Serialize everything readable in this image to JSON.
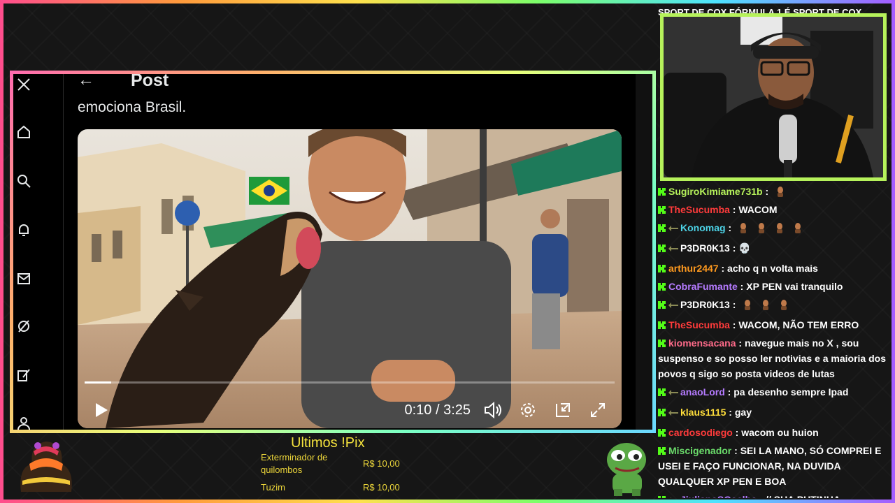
{
  "post": {
    "back_icon": "←",
    "title": "Post",
    "text": "emociona Brasil."
  },
  "sidebar": {
    "icons": [
      "x-logo-icon",
      "home-icon",
      "search-icon",
      "notifications-icon",
      "messages-icon",
      "grok-icon",
      "compose-icon",
      "profile-icon"
    ]
  },
  "video": {
    "time": "0:10 / 3:25",
    "progress": 0.05
  },
  "marquee": {
    "text": "SPORT DE COX FÓRMULA 1 É SPORT DE COX"
  },
  "chat": {
    "messages": [
      {
        "user": "SugiroKimiame731b",
        "color": "#b6f25b",
        "text": "",
        "emotes": 1,
        "sub": false
      },
      {
        "user": "TheSucumba",
        "color": "#ff3b3b",
        "text": "WACOM",
        "emotes": 0,
        "sub": false
      },
      {
        "user": "Konomag",
        "color": "#4dd4e8",
        "text": "",
        "emotes": 4,
        "sub": true
      },
      {
        "user": "P3DR0K13",
        "color": "#ffffff",
        "text": "💀",
        "emotes": 0,
        "sub": true
      },
      {
        "user": "arthur2447",
        "color": "#ff9a1f",
        "text": "acho q n volta mais",
        "emotes": 0,
        "sub": false
      },
      {
        "user": "CobraFumante",
        "color": "#b57bff",
        "text": "XP PEN vai tranquilo",
        "emotes": 0,
        "sub": false
      },
      {
        "user": "P3DR0K13",
        "color": "#ffffff",
        "text": "",
        "emotes": 3,
        "sub": true
      },
      {
        "user": "TheSucumba",
        "color": "#ff3b3b",
        "text": "WACOM, NÃO TEM ERRO",
        "emotes": 0,
        "sub": false
      },
      {
        "user": "kiomensacana",
        "color": "#ff6b8a",
        "text": "navegue mais no X , sou suspenso e so posso ler notivias e a maioria dos povos q sigo so posta videos de lutas",
        "emotes": 0,
        "sub": false
      },
      {
        "user": "anaoLord",
        "color": "#b57bff",
        "text": "pa desenho sempre Ipad",
        "emotes": 0,
        "sub": true
      },
      {
        "user": "klaus1115",
        "color": "#ffde3b",
        "text": "gay",
        "emotes": 0,
        "sub": true
      },
      {
        "user": "cardosodiego",
        "color": "#ff3b3b",
        "text": "wacom ou huion",
        "emotes": 0,
        "sub": false
      },
      {
        "user": "Miscigenador",
        "color": "#6bdc6b",
        "text": "SEI LA MANO, SÓ COMPREI E USEI E FAÇO FUNCIONAR, NA DUVIDA QUALQUER XP PEN E BOA",
        "emotes": 0,
        "sub": false
      },
      {
        "user": "JiulianoSCoelho",
        "color": "#b57bff",
        "text": "// SUA PUTINHA",
        "emotes": 0,
        "sub": true
      }
    ]
  },
  "pix": {
    "title": "Ultimos !Pix",
    "entries": [
      {
        "name": "Exterminador de quilombos",
        "value": "R$ 10,00"
      },
      {
        "name": "Tuzim",
        "value": "R$ 10,00"
      }
    ]
  },
  "colors": {
    "webcam_border": "#b6f25b",
    "pix_text": "#ecd63a"
  }
}
